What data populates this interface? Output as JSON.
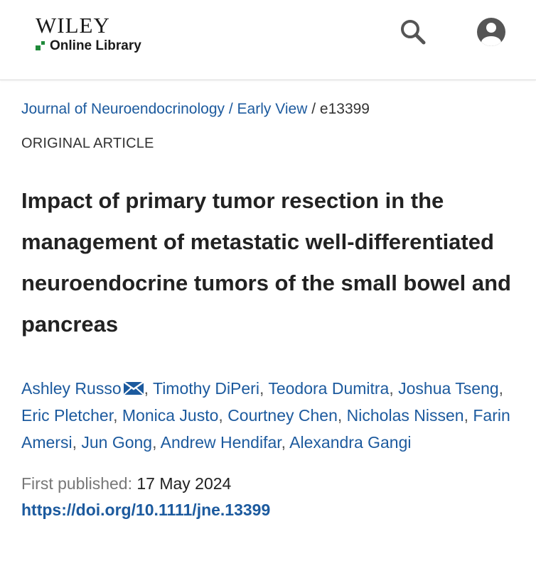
{
  "header": {
    "brand": "WILEY",
    "subbrand": "Online Library",
    "search_icon": "search-icon",
    "account_icon": "account-circle-icon"
  },
  "breadcrumb": {
    "journal": "Journal of Neuroendocrinology",
    "separator": "/",
    "section": "Early View",
    "article_id": "e13399"
  },
  "article": {
    "type": "ORIGINAL ARTICLE",
    "title": "Impact of primary tumor resection in the management of metastatic well-differentiated neuroendocrine tumors of the small bowel and pancreas",
    "authors": [
      "Ashley Russo",
      "Timothy DiPeri",
      "Teodora Dumitra",
      "Joshua Tseng",
      "Eric Pletcher",
      "Monica Justo",
      "Courtney Chen",
      "Nicholas Nissen",
      "Farin Amersi",
      "Jun Gong",
      "Andrew Hendifar",
      "Alexandra Gangi"
    ],
    "corresponding_icon": "envelope-icon",
    "published_label": "First published:",
    "published_date": "17 May 2024",
    "doi": "https://doi.org/10.1111/jne.13399"
  },
  "colors": {
    "link": "#1c5a9e",
    "brand_green": "#1f8a3a",
    "text": "#222222",
    "muted": "#777777"
  }
}
